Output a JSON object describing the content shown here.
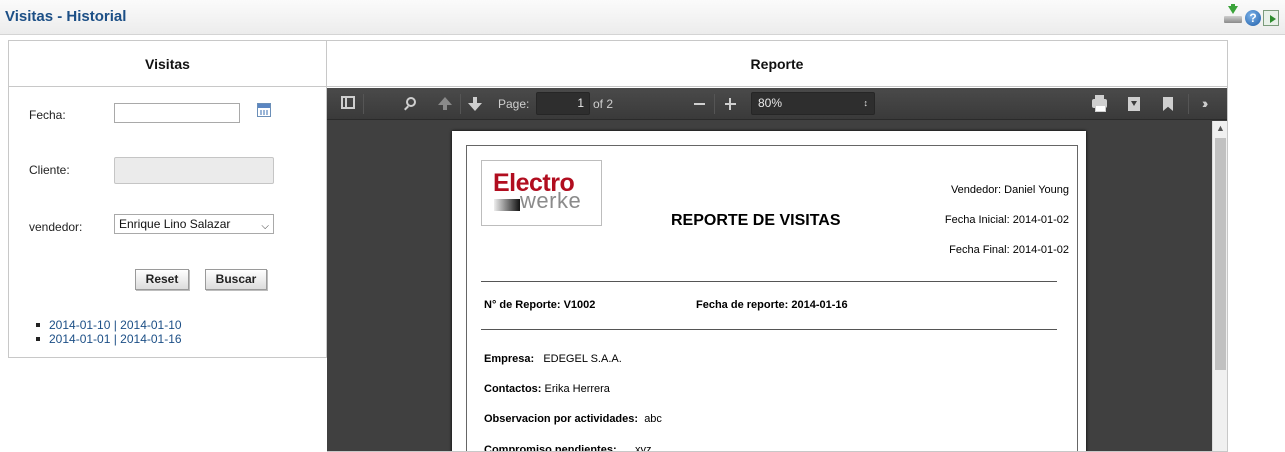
{
  "header": {
    "title": "Visitas - Historial"
  },
  "left": {
    "title": "Visitas",
    "fecha_label": "Fecha:",
    "fecha_value": "",
    "cliente_label": "Cliente:",
    "cliente_value": "",
    "vendedor_label": "vendedor:",
    "vendedor_selected": "Enrique Lino Salazar",
    "reset_label": "Reset",
    "buscar_label": "Buscar",
    "history_links": [
      "2014-01-10 | 2014-01-10",
      "2014-01-01 | 2014-01-16"
    ]
  },
  "right": {
    "title": "Reporte",
    "pdf_toolbar": {
      "page_label": "Page:",
      "page_number": "1",
      "page_total": "of 2",
      "zoom": "80%"
    },
    "report": {
      "logo_line1": "Electro",
      "logo_line2": "werke",
      "title": "REPORTE DE VISITAS",
      "vendedor": "Vendedor: Daniel Young",
      "fecha_inicial": "Fecha Inicial: 2014-01-02",
      "fecha_final": "Fecha Final: 2014-01-02",
      "numero_label": "N° de Reporte:",
      "numero_value": "V1002",
      "fecha_reporte_label": "Fecha de reporte:",
      "fecha_reporte_value": "2014-01-16",
      "empresa_label": "Empresa:",
      "empresa_value": "EDEGEL S.A.A.",
      "contactos_label": "Contactos:",
      "contactos_value": "Erika Herrera",
      "observacion_label": "Observacion por actividades:",
      "observacion_value": "abc",
      "compromiso_label": "Compromiso pendientes:",
      "compromiso_value": "xyz"
    }
  },
  "colors": {
    "header_title": "#1c4f86",
    "viewer_bg": "#404040",
    "logo_red": "#b10d1f"
  }
}
